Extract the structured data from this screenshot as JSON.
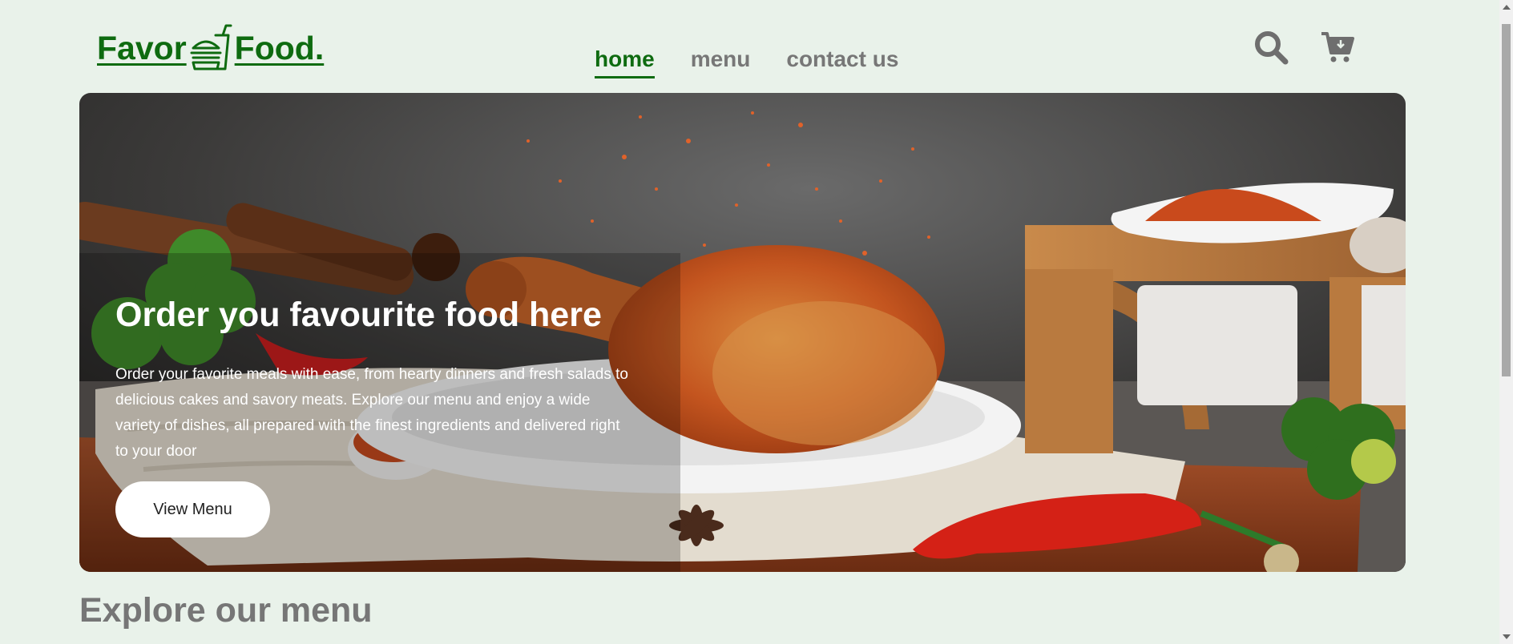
{
  "header": {
    "logo": {
      "part1": "Favor",
      "part2": "Food."
    },
    "nav": [
      {
        "label": "home",
        "active": true
      },
      {
        "label": "menu",
        "active": false
      },
      {
        "label": "contact us",
        "active": false
      }
    ],
    "icons": [
      "search-icon",
      "cart-icon"
    ]
  },
  "hero": {
    "title": "Order you favourite food here",
    "description": "Order your favorite meals with ease, from hearty dinners and fresh salads to delicious cakes and savory meats. Explore our menu and enjoy a wide variety of dishes, all prepared with the finest ingredients and delivered right to your door",
    "button_label": "View Menu"
  },
  "explore": {
    "title": "Explore our menu"
  },
  "colors": {
    "brand": "#0e6b10",
    "page_bg": "#e9f2ea",
    "nav_inactive": "#777777"
  }
}
